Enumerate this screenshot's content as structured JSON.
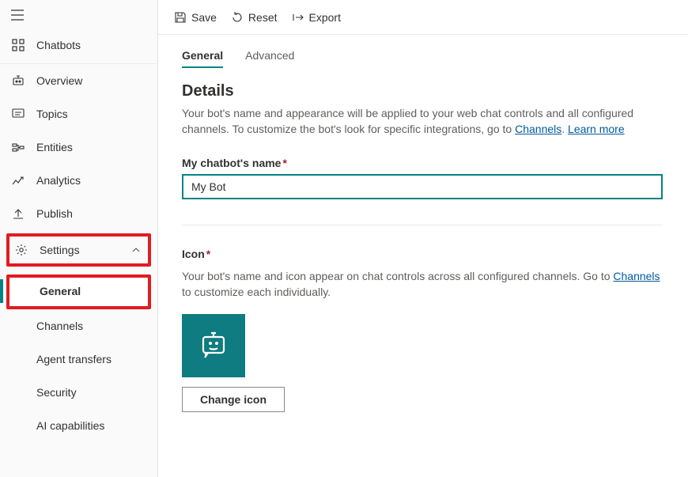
{
  "sidebar": {
    "chatbots": "Chatbots",
    "items": [
      {
        "label": "Overview"
      },
      {
        "label": "Topics"
      },
      {
        "label": "Entities"
      },
      {
        "label": "Analytics"
      },
      {
        "label": "Publish"
      }
    ],
    "settings": {
      "label": "Settings",
      "children": [
        {
          "label": "General"
        },
        {
          "label": "Channels"
        },
        {
          "label": "Agent transfers"
        },
        {
          "label": "Security"
        },
        {
          "label": "AI capabilities"
        }
      ]
    }
  },
  "toolbar": {
    "save": "Save",
    "reset": "Reset",
    "export": "Export"
  },
  "tabs": {
    "general": "General",
    "advanced": "Advanced"
  },
  "details": {
    "title": "Details",
    "desc_a": "Your bot's name and appearance will be applied to your web chat controls and all configured channels. To customize the bot's look for specific integrations, go to ",
    "channels_link": "Channels",
    "desc_b": ". ",
    "learn_more": "Learn more",
    "name_label": "My chatbot's name",
    "name_value": "My Bot"
  },
  "icon": {
    "label": "Icon",
    "desc_a": "Your bot's name and icon appear on chat controls across all configured channels. Go to ",
    "channels_link": "Channels",
    "desc_b": " to customize each individually.",
    "button": "Change icon"
  }
}
